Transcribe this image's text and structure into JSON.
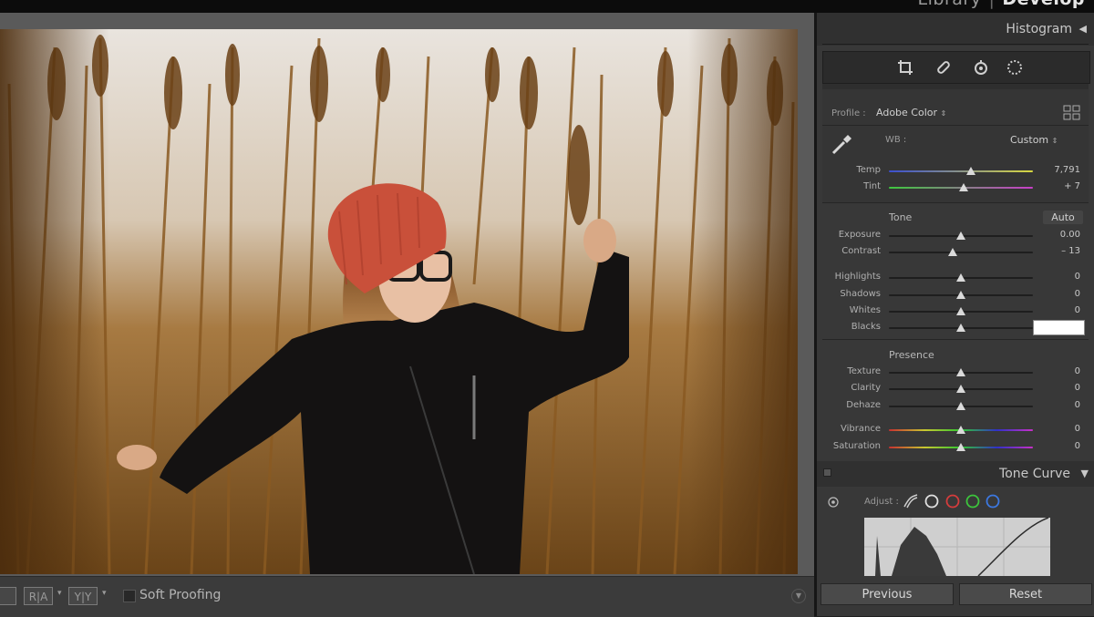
{
  "module_picker": {
    "library": "Library",
    "develop": "Develop"
  },
  "histogram": {
    "title": "Histogram"
  },
  "profile": {
    "label": "Profile :",
    "value": "Adobe Color"
  },
  "wb": {
    "label": "WB :",
    "value": "Custom"
  },
  "temp": {
    "label": "Temp",
    "value": "7,791",
    "level": 0.57
  },
  "tint": {
    "label": "Tint",
    "value": "+ 7",
    "level": 0.52
  },
  "tone": {
    "title": "Tone",
    "auto_label": "Auto",
    "sliders": [
      {
        "label": "Exposure",
        "value": "0.00",
        "level": 0.5
      },
      {
        "label": "Contrast",
        "value": "– 13",
        "level": 0.44
      },
      {
        "label": "Highlights",
        "value": "0",
        "level": 0.5
      },
      {
        "label": "Shadows",
        "value": "0",
        "level": 0.5
      },
      {
        "label": "Whites",
        "value": "0",
        "level": 0.5
      },
      {
        "label": "Blacks",
        "value": "",
        "level": 0.5
      }
    ]
  },
  "presence": {
    "title": "Presence",
    "sliders": [
      {
        "label": "Texture",
        "value": "0",
        "level": 0.5
      },
      {
        "label": "Clarity",
        "value": "0",
        "level": 0.5
      },
      {
        "label": "Dehaze",
        "value": "0",
        "level": 0.5
      },
      {
        "label": "Vibrance",
        "value": "0",
        "level": 0.5
      },
      {
        "label": "Saturation",
        "value": "0",
        "level": 0.5
      }
    ]
  },
  "tone_curve": {
    "title": "Tone Curve",
    "adjust_label": "Adjust :"
  },
  "toolbar": {
    "view_label": "",
    "ra_label": "R|A",
    "yy_label": "Y|Y",
    "soft_proofing": "Soft Proofing"
  },
  "buttons": {
    "previous": "Previous",
    "reset": "Reset"
  },
  "colors": {
    "panel": "#383838",
    "accent_temp_left": "#3b4fd0",
    "accent_temp_right": "#d8d840",
    "tint_left": "#3ec83e",
    "tint_right": "#c83ec8"
  },
  "icons": [
    "crop-icon",
    "healing-brush-icon",
    "red-eye-icon",
    "masking-icon",
    "eyedropper-icon",
    "grid-icon",
    "target-adjust-icon"
  ]
}
